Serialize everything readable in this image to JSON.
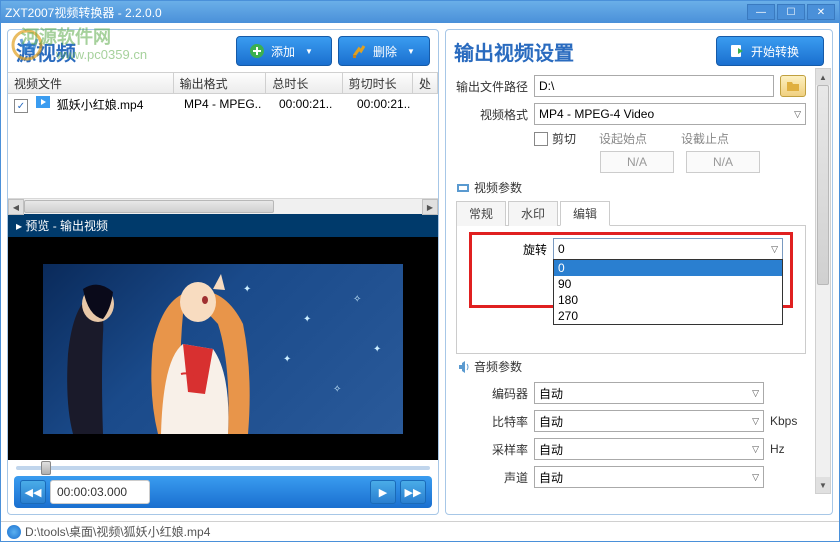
{
  "titlebar": {
    "title": "ZXT2007视频转换器 - 2.2.0.0"
  },
  "watermark": {
    "text": "河源软件网",
    "url": "www.pc0359.cn"
  },
  "left": {
    "title": "源视频",
    "add_label": "添加",
    "del_label": "删除",
    "columns": {
      "file": "视频文件",
      "fmt": "输出格式",
      "dur": "总时长",
      "cut": "剪切时长",
      "proc": "处"
    },
    "rows": [
      {
        "name": "狐妖小红娘.mp4",
        "fmt": "MP4 - MPEG..",
        "dur": "00:00:21..",
        "cut": "00:00:21.."
      }
    ],
    "preview_label": "▸ 预览 - 输出视频",
    "time": "00:00:03.000"
  },
  "right": {
    "title": "输出视频设置",
    "start_label": "开始转换",
    "outpath_label": "输出文件路径",
    "outpath": "D:\\",
    "fmt_label": "视频格式",
    "fmt": "MP4 - MPEG-4 Video",
    "cut_label": "剪切",
    "startpt_label": "设起始点",
    "endpt_label": "设截止点",
    "na": "N/A",
    "video_params": "视频参数",
    "tabs": {
      "general": "常规",
      "watermark": "水印",
      "edit": "编辑"
    },
    "rotate_label": "旋转",
    "rotate_value": "0",
    "rotate_options": [
      "0",
      "90",
      "180",
      "270"
    ],
    "audio_params": "音频参数",
    "encoder_label": "编码器",
    "bitrate_label": "比特率",
    "samplerate_label": "采样率",
    "channel_label": "声道",
    "auto": "自动",
    "kbps": "Kbps",
    "hz": "Hz"
  },
  "statusbar": {
    "path": "D:\\tools\\桌面\\视频\\狐妖小红娘.mp4"
  }
}
